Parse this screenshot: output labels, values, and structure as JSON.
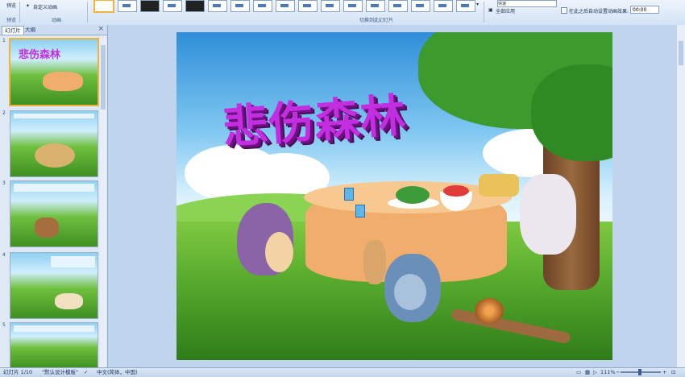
{
  "ribbon": {
    "preview_label": "预览",
    "custom_animation_label": "自定义动画",
    "group_preview": "预览",
    "group_animation": "动画",
    "group_transition": "切换到此幻灯片",
    "transition_speed_value": "快速",
    "apply_all_label": "全部应用",
    "auto_advance_label": "在此之后自动设置动画效果:",
    "auto_advance_time": "00:00"
  },
  "left_pane": {
    "tabs": [
      "幻灯片",
      "大纲"
    ],
    "close_symbol": "×",
    "slide_numbers": [
      "1",
      "2",
      "3",
      "4",
      "5"
    ]
  },
  "slide": {
    "title": "悲伤森林"
  },
  "status_bar": {
    "slide_info": "幻灯片 1/10",
    "theme": "\"默认设计模板\"",
    "language": "中文(简体，中国)",
    "zoom": "111%"
  },
  "colors": {
    "accent": "#f0b43c",
    "title": "#c32ee0",
    "ribbon": "#d3e2f5"
  }
}
